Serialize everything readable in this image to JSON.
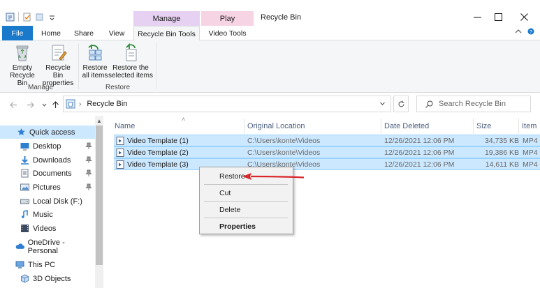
{
  "window": {
    "title": "Recycle Bin",
    "context_group_manage": "Manage",
    "context_group_play": "Play"
  },
  "ribbon_tabs": {
    "file": "File",
    "home": "Home",
    "share": "Share",
    "view": "View",
    "recycle_bin_tools": "Recycle Bin Tools",
    "video_tools": "Video Tools"
  },
  "ribbon": {
    "empty_line1": "Empty",
    "empty_line2": "Recycle Bin",
    "props_line1": "Recycle Bin",
    "props_line2": "properties",
    "restore_all_line1": "Restore",
    "restore_all_line2": "all items",
    "restore_sel_line1": "Restore the",
    "restore_sel_line2": "selected items",
    "group_manage": "Manage",
    "group_restore": "Restore"
  },
  "address": {
    "path": "Recycle Bin",
    "search_placeholder": "Search Recycle Bin"
  },
  "nav_pane": {
    "quick_access": "Quick access",
    "desktop": "Desktop",
    "downloads": "Downloads",
    "documents": "Documents",
    "pictures": "Pictures",
    "local_disk": "Local Disk (F:)",
    "music": "Music",
    "videos": "Videos",
    "onedrive": "OneDrive - Personal",
    "this_pc": "This PC",
    "objects_3d": "3D Objects"
  },
  "columns": {
    "name": "Name",
    "original_location": "Original Location",
    "date_deleted": "Date Deleted",
    "size": "Size",
    "item_type": "Item"
  },
  "files": [
    {
      "name": "Video Template (1)",
      "location": "C:\\Users\\konte\\Videos",
      "date": "12/26/2021 12:06 PM",
      "size": "34,735 KB",
      "type": "MP4"
    },
    {
      "name": "Video Template (2)",
      "location": "C:\\Users\\konte\\Videos",
      "date": "12/26/2021 12:06 PM",
      "size": "19,386 KB",
      "type": "MP4"
    },
    {
      "name": "Video Template (3)",
      "location": "C:\\Users\\konte\\Videos",
      "date": "12/26/2021 12:06 PM",
      "size": "14,611 KB",
      "type": "MP4"
    }
  ],
  "context_menu": {
    "restore": "Restore",
    "cut": "Cut",
    "delete": "Delete",
    "properties": "Properties"
  },
  "colors": {
    "accent": "#1979ca",
    "selection": "#cce8ff",
    "annotation_arrow": "#d9262b"
  }
}
